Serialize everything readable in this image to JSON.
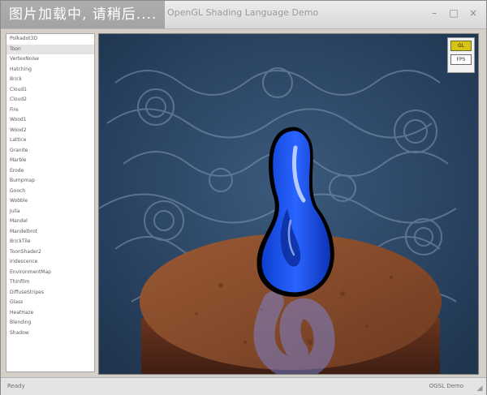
{
  "loading_banner": "图片加载中, 请稍后....",
  "window": {
    "title": "OpenGL Shading Language Demo"
  },
  "title_buttons": {
    "minimize": "–",
    "maximize": "□",
    "close": "×"
  },
  "sidebar": {
    "items": [
      {
        "label": "Polkadot3D",
        "selected": false
      },
      {
        "label": "Toon",
        "selected": true
      },
      {
        "label": "VertexNoise",
        "selected": false
      },
      {
        "label": "Hatching",
        "selected": false
      },
      {
        "label": "Brick",
        "selected": false
      },
      {
        "label": "Cloud1",
        "selected": false
      },
      {
        "label": "Cloud2",
        "selected": false
      },
      {
        "label": "Fire",
        "selected": false
      },
      {
        "label": "Wood1",
        "selected": false
      },
      {
        "label": "Wood2",
        "selected": false
      },
      {
        "label": "Lattice",
        "selected": false
      },
      {
        "label": "Granite",
        "selected": false
      },
      {
        "label": "Marble",
        "selected": false
      },
      {
        "label": "Erode",
        "selected": false
      },
      {
        "label": "Bumpmap",
        "selected": false
      },
      {
        "label": "Gooch",
        "selected": false
      },
      {
        "label": "Wobble",
        "selected": false
      },
      {
        "label": "Julia",
        "selected": false
      },
      {
        "label": "Mandel",
        "selected": false
      },
      {
        "label": "Mandelbrot",
        "selected": false
      },
      {
        "label": "BrickTile",
        "selected": false
      },
      {
        "label": "ToonShader2",
        "selected": false
      },
      {
        "label": "Iridescence",
        "selected": false
      },
      {
        "label": "EnvironmentMap",
        "selected": false
      },
      {
        "label": "Thinfilm",
        "selected": false
      },
      {
        "label": "DiffuseStripes",
        "selected": false
      },
      {
        "label": "Glass",
        "selected": false
      },
      {
        "label": "HeatHaze",
        "selected": false
      },
      {
        "label": "Blending",
        "selected": false
      },
      {
        "label": "Shadow",
        "selected": false
      }
    ]
  },
  "viewport": {
    "badge_top": "GL",
    "badge_bottom": "FPS",
    "colors": {
      "background": "#2e4a6a",
      "swirl": "#6f8aa8",
      "pedestal": "#8a4a2a",
      "pedestal_dark": "#5a2e1a",
      "object": "#1a52e8",
      "object_highlight": "#b8cbff"
    }
  },
  "statusbar": {
    "left": "Ready",
    "right": "OGSL Demo"
  }
}
